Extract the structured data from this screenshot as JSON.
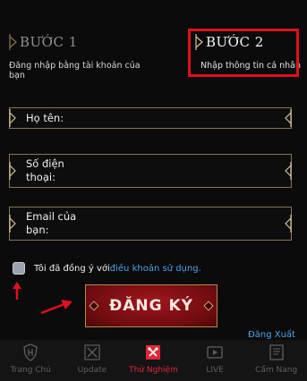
{
  "steps": [
    {
      "title": "BƯỚC 1",
      "subtitle": "Đăng nhập bằng tài khoản của bạn"
    },
    {
      "title": "BƯỚC 2",
      "subtitle": "Nhập thông tin cá nhân"
    }
  ],
  "form": {
    "name_label": "Họ tên:",
    "phone_label": "Số điện\nthoại:",
    "email_label": "Email của\nbạn:"
  },
  "agreement": {
    "text": "Tôi đã đồng ý với ",
    "link": "điều khoản sử dụng."
  },
  "register_button": "ĐĂNG KÝ",
  "logout_link": "Đăng Xuất",
  "nav": [
    {
      "label": "Trang Chủ",
      "icon": "shield-icon",
      "active": false
    },
    {
      "label": "Update",
      "icon": "swords-icon",
      "active": false
    },
    {
      "label": "Thử Nghiệm",
      "icon": "tools-icon",
      "active": true
    },
    {
      "label": "LIVE",
      "icon": "play-icon",
      "active": false
    },
    {
      "label": "Cẩm Nang",
      "icon": "book-icon",
      "active": false
    }
  ],
  "colors": {
    "accent_red": "#e0283a",
    "highlight_red": "#e0101a",
    "link_blue": "#4da3e8",
    "gold_border": "#8a7650"
  }
}
